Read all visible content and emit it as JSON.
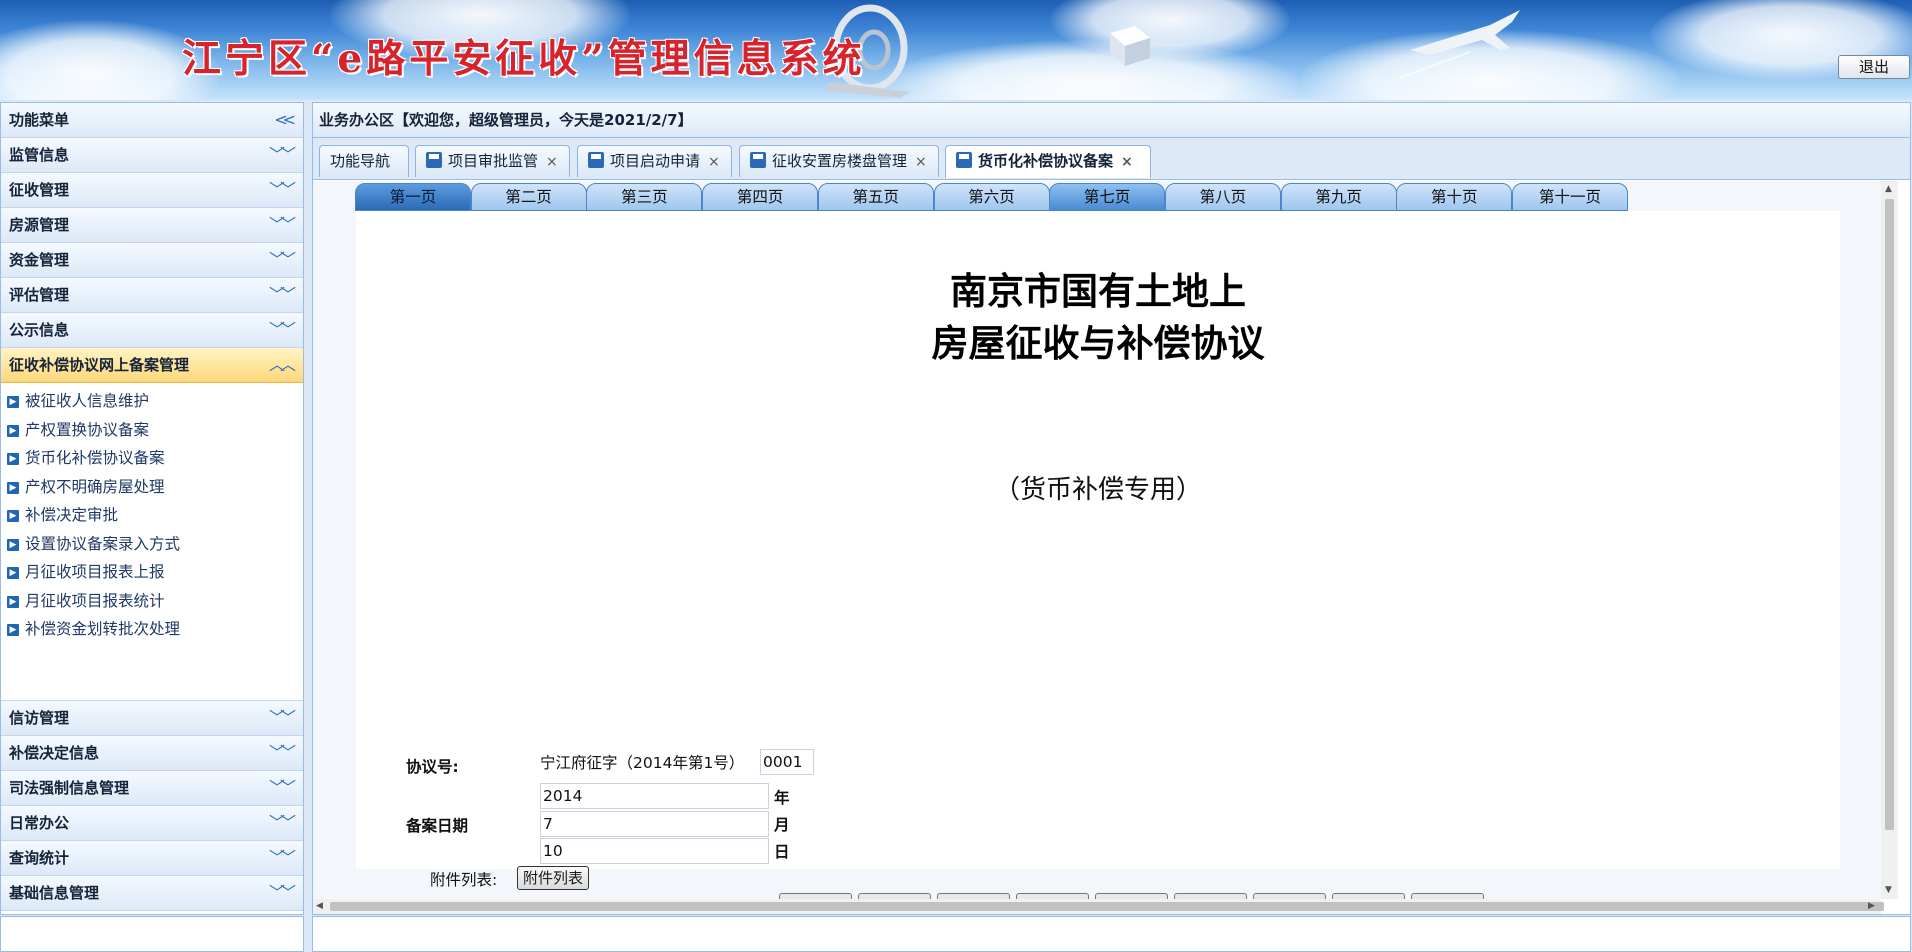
{
  "banner": {
    "title": "江宁区“e路平安征收”管理信息系统",
    "logout_label": "退出"
  },
  "sidebar": {
    "title": "功能菜单",
    "collapse_icon": "double-chevron-left-icon",
    "groups_top": [
      {
        "label": "监管信息"
      },
      {
        "label": "征收管理"
      },
      {
        "label": "房源管理"
      },
      {
        "label": "资金管理"
      },
      {
        "label": "评估管理"
      },
      {
        "label": "公示信息"
      }
    ],
    "active_group": {
      "label": "征收补偿协议网上备案管理",
      "items": [
        {
          "label": "被征收人信息维护"
        },
        {
          "label": "产权置换协议备案"
        },
        {
          "label": "货币化补偿协议备案"
        },
        {
          "label": "产权不明确房屋处理"
        },
        {
          "label": "补偿决定审批"
        },
        {
          "label": "设置协议备案录入方式"
        },
        {
          "label": "月征收项目报表上报"
        },
        {
          "label": "月征收项目报表统计"
        },
        {
          "label": "补偿资金划转批次处理"
        }
      ]
    },
    "groups_bottom": [
      {
        "label": "信访管理"
      },
      {
        "label": "补偿决定信息"
      },
      {
        "label": "司法强制信息管理"
      },
      {
        "label": "日常办公"
      },
      {
        "label": "查询统计"
      },
      {
        "label": "基础信息管理"
      }
    ]
  },
  "main": {
    "header": "业务办公区【欢迎您，超级管理员，今天是2021/2/7】",
    "tabs": [
      {
        "label": "功能导航",
        "closable": false,
        "active": false
      },
      {
        "label": "项目审批监管",
        "closable": true,
        "active": false
      },
      {
        "label": "项目启动申请",
        "closable": true,
        "active": false
      },
      {
        "label": "征收安置房楼盘管理",
        "closable": true,
        "active": false
      },
      {
        "label": "货币化补偿协议备案",
        "closable": true,
        "active": true
      }
    ],
    "close_glyph": "×"
  },
  "document": {
    "page_tabs": [
      "第一页",
      "第二页",
      "第三页",
      "第四页",
      "第五页",
      "第六页",
      "第七页",
      "第八页",
      "第九页",
      "第十页",
      "第十一页"
    ],
    "current_page_tab": 0,
    "title_line1": "南京市国有土地上",
    "title_line2": "房屋征收与补偿协议",
    "subtitle": "（货币补偿专用）",
    "agreement_label": "协议号:",
    "agreement_prefix": "宁江府征字（2014年第1号）",
    "agreement_no": "0001",
    "filing_date_label": "备案日期",
    "year_value": "2014",
    "year_unit": "年",
    "month_value": "7",
    "month_unit": "月",
    "day_value": "10",
    "day_unit": "日",
    "attachment_label": "附件列表:",
    "attachment_button": "附件列表"
  },
  "colors": {
    "banner_title": "#d7232b",
    "panel_border": "#99bbe8",
    "active_menu": "#ffd77a",
    "page_tab_current": "#2b6bb5"
  }
}
